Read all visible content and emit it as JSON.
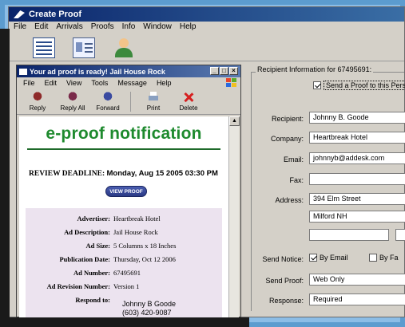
{
  "app": {
    "title": "Create Proof",
    "menu": [
      "File",
      "Edit",
      "Arrivals",
      "Proofs",
      "Info",
      "Window",
      "Help"
    ]
  },
  "form": {
    "legend": "Recipient Information for 67495691:",
    "send_proof_label": "Send a Proof to this Perso",
    "recipient_label": "Recipient:",
    "recipient_value": "Johnny B. Goode",
    "company_label": "Company:",
    "company_value": "Heartbreak Hotel",
    "email_label": "Email:",
    "email_value": "johnnyb@addesk.com",
    "fax_label": "Fax:",
    "fax_value": "",
    "address_label": "Address:",
    "address_line1": "394 Elm Street",
    "address_line2": "Milford NH",
    "send_notice_label": "Send Notice:",
    "by_email_label": "By Email",
    "by_fax_label": "By Fa",
    "send_proof_via_label": "Send Proof:",
    "send_proof_via_value": "Web Only",
    "response_label": "Response:",
    "response_value": "Required"
  },
  "mail": {
    "title": "Your ad proof is ready! Jail House Rock",
    "menu": [
      "File",
      "Edit",
      "View",
      "Tools",
      "Message",
      "Help"
    ],
    "toolbar": {
      "reply": "Reply",
      "reply_all": "Reply All",
      "forward": "Forward",
      "print": "Print",
      "delete": "Delete"
    },
    "heading": "e-proof notification",
    "deadline_label": "REVIEW DEADLINE:",
    "deadline_value": "Monday, Aug 15 2005 03:30 PM",
    "view_proof": "VIEW PROOF",
    "details": [
      {
        "k": "Advertiser:",
        "v": "Heartbreak Hotel"
      },
      {
        "k": "Ad Description:",
        "v": "Jail House Rock"
      },
      {
        "k": "Ad Size:",
        "v": "5 Columns x 18 Inches"
      },
      {
        "k": "Publication Date:",
        "v": "Thursday, Oct 12 2006"
      },
      {
        "k": "Ad Number:",
        "v": "67495691"
      },
      {
        "k": "Ad Revision Number:",
        "v": "Version 1"
      },
      {
        "k": "Respond to:",
        "v": ""
      }
    ],
    "respond_name": "Johnny B Goode",
    "respond_phone": "(603) 420-9087"
  }
}
